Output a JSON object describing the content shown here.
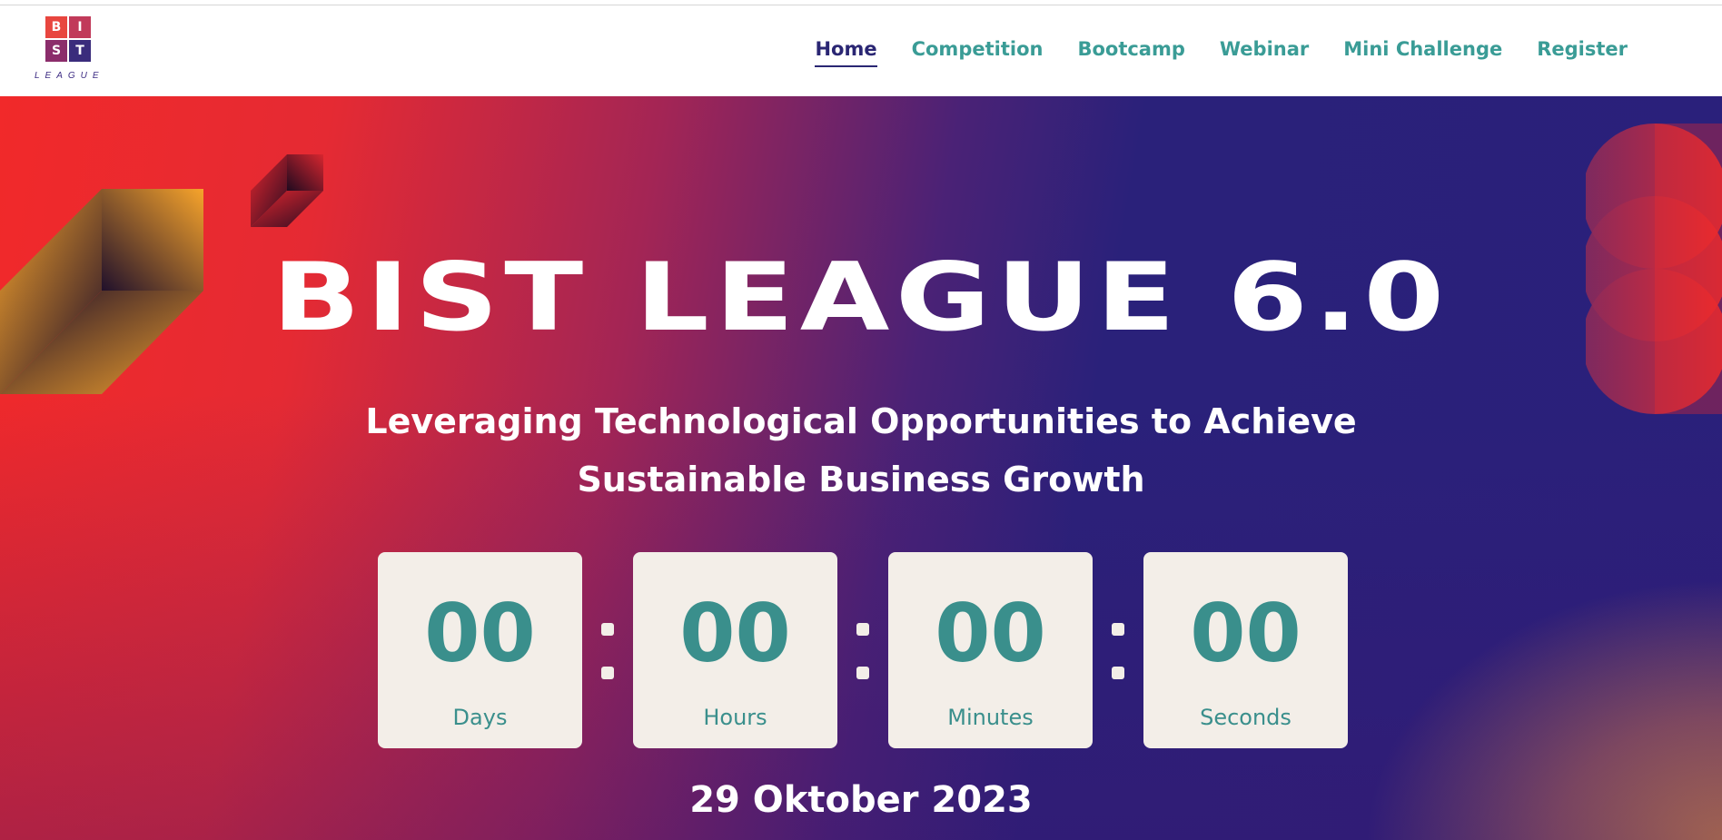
{
  "brand": {
    "logo_letters": [
      "B",
      "I",
      "S",
      "T"
    ],
    "logo_word": "LEAGUE"
  },
  "nav": {
    "items": [
      {
        "label": "Home",
        "active": true
      },
      {
        "label": "Competition",
        "active": false
      },
      {
        "label": "Bootcamp",
        "active": false
      },
      {
        "label": "Webinar",
        "active": false
      },
      {
        "label": "Mini Challenge",
        "active": false
      },
      {
        "label": "Register",
        "active": false
      }
    ]
  },
  "hero": {
    "title": "BIST LEAGUE 6.0",
    "subtitle_line1": "Leveraging Technological Opportunities to Achieve",
    "subtitle_line2": "Sustainable Business Growth",
    "date": "29 Oktober 2023",
    "countdown": [
      {
        "value": "00",
        "label": "Days"
      },
      {
        "value": "00",
        "label": "Hours"
      },
      {
        "value": "00",
        "label": "Minutes"
      },
      {
        "value": "00",
        "label": "Seconds"
      }
    ]
  },
  "colors": {
    "nav_text": "#3a9c96",
    "nav_active": "#2a2673",
    "hero_red": "#f1292a",
    "hero_indigo": "#2a217a",
    "countdown_bg": "#f3eee8",
    "countdown_text": "#3a8f8c",
    "accent_orange": "#f5a12c"
  },
  "icons": {
    "logo": "bist-league-logo",
    "cube_large": "gradient-cube-icon",
    "cube_small": "gradient-cube-small-icon",
    "circles": "half-circles-icon"
  }
}
